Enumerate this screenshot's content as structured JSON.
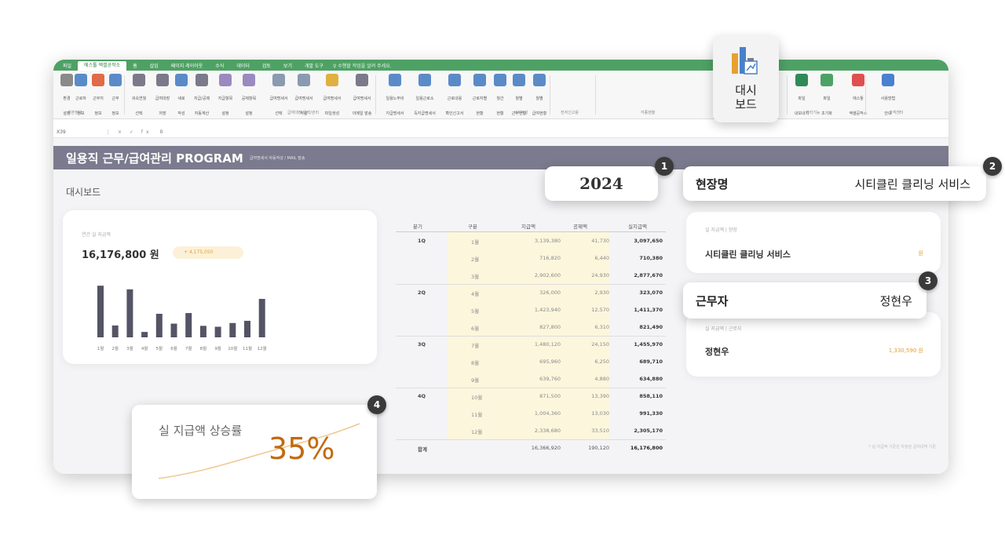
{
  "ribbon_tabs": [
    "파일",
    "에스툴 엑셀공작소",
    "홈",
    "삽입",
    "페이지 레이아웃",
    "수식",
    "데이터",
    "검토",
    "보기",
    "개발 도구"
  ],
  "tell_me": "♀ 수행할 작업을 알려 주세요.",
  "ribbon_buttons": [
    {
      "label": "환경\n설정",
      "icon": "gear-icon",
      "color": "#8a8a8a"
    },
    {
      "label": "근로자\n정보",
      "icon": "people-icon",
      "color": "#5a8bc8"
    },
    {
      "label": "근무지\n정보",
      "icon": "flag-icon",
      "color": "#e06a4a"
    },
    {
      "label": "근무\n정보",
      "icon": "clock-icon",
      "color": "#5a8bc8"
    },
    {
      "label": "귀속연월\n선택",
      "icon": "calendar-icon",
      "color": "#7a7a8a"
    },
    {
      "label": "급여대장\n저장",
      "icon": "save-icon",
      "color": "#7a7a8a"
    },
    {
      "label": "새로\n작성",
      "icon": "new-doc-icon",
      "color": "#5a8bc8"
    },
    {
      "label": "지급/공제\n자동계산",
      "icon": "calc-icon",
      "color": "#7a7a8a"
    },
    {
      "label": "지급항목\n설정",
      "icon": "edit-icon",
      "color": "#9a8ac0"
    },
    {
      "label": "공제항목\n설정",
      "icon": "edit-icon",
      "color": "#9a8ac0"
    },
    {
      "label": "급여명세서\n선택",
      "icon": "cursor-icon",
      "color": "#8a9ab0"
    },
    {
      "label": "급여명세서\n작성",
      "icon": "cursor-icon",
      "color": "#8a9ab0"
    },
    {
      "label": "급여명세서\n파일생성",
      "icon": "mail-icon",
      "color": "#e0b040"
    },
    {
      "label": "급여명세서\n이메일 발송",
      "icon": "send-icon",
      "color": "#7a7a8a"
    },
    {
      "label": "일용노무비\n지급명세서",
      "icon": "doc-icon",
      "color": "#5a8bc8"
    },
    {
      "label": "일용근로소\n득지급명세서",
      "icon": "doc-icon",
      "color": "#5a8bc8"
    },
    {
      "label": "근로내용\n확인신고서",
      "icon": "doc-icon",
      "color": "#5a8bc8"
    },
    {
      "label": "근로자별\n현황",
      "icon": "search-icon",
      "color": "#5a8bc8"
    },
    {
      "label": "월간\n현황",
      "icon": "calendar-icon",
      "color": "#5a8bc8"
    },
    {
      "label": "월별\n근무현황",
      "icon": "grid-icon",
      "color": "#5a8bc8"
    },
    {
      "label": "월별\n급여현황",
      "icon": "grid-icon",
      "color": "#5a8bc8"
    },
    {
      "label": "파일\n내보내기",
      "icon": "excel-icon",
      "color": "#2e8b57"
    },
    {
      "label": "파일\n초기화",
      "icon": "refresh-icon",
      "color": "#4ea164"
    },
    {
      "label": "에스툴\n엑셀공작소",
      "icon": "logo-icon",
      "color": "#e05050"
    },
    {
      "label": "사용방법\n안내",
      "icon": "info-icon",
      "color": "#4a80d0"
    }
  ],
  "ribbon_groups": [
    "기본정보",
    "급여대장 입력/관리",
    "서식작성",
    "전자신고용",
    "각종현황",
    "관리기능",
    "고객센터"
  ],
  "dashboard_button": {
    "line1": "대시",
    "line2": "보드"
  },
  "formula_bar": {
    "cell": "X39",
    "fx": "× ✓ fx",
    "formula": "0"
  },
  "title": "일용직 근무/급여관리 PROGRAM",
  "subtitle": "급여명세서 자동작성 / MAIL 발송",
  "dashboard_label": "대시보드",
  "annual_pay": {
    "label": "연간 실 지급액",
    "value": "16,176,800 원",
    "delta": "+ 4,175,050"
  },
  "chart_data": {
    "type": "bar",
    "categories": [
      "1월",
      "2월",
      "3월",
      "4월",
      "5월",
      "6월",
      "7월",
      "8월",
      "9월",
      "10월",
      "11월",
      "12월"
    ],
    "values": [
      3097650,
      710380,
      2877670,
      323070,
      1411370,
      821490,
      1455970,
      689710,
      634880,
      858110,
      991330,
      2305170
    ],
    "ylim": [
      0,
      3200000
    ],
    "color": "#545466"
  },
  "table": {
    "headers": [
      "분기",
      "구분",
      "지급액",
      "공제액",
      "실지급액"
    ],
    "rows": [
      {
        "q": "1Q",
        "m": "1월",
        "a": "3,139,380",
        "d": "41,730",
        "n": "3,097,650"
      },
      {
        "q": "",
        "m": "2월",
        "a": "716,820",
        "d": "6,440",
        "n": "710,380"
      },
      {
        "q": "",
        "m": "3월",
        "a": "2,902,600",
        "d": "24,930",
        "n": "2,877,670"
      },
      {
        "q": "2Q",
        "m": "4월",
        "a": "326,000",
        "d": "2,930",
        "n": "323,070"
      },
      {
        "q": "",
        "m": "5월",
        "a": "1,423,940",
        "d": "12,570",
        "n": "1,411,370"
      },
      {
        "q": "",
        "m": "6월",
        "a": "827,800",
        "d": "6,310",
        "n": "821,490"
      },
      {
        "q": "3Q",
        "m": "7월",
        "a": "1,480,120",
        "d": "24,150",
        "n": "1,455,970"
      },
      {
        "q": "",
        "m": "8월",
        "a": "695,960",
        "d": "6,250",
        "n": "689,710"
      },
      {
        "q": "",
        "m": "9월",
        "a": "639,760",
        "d": "4,880",
        "n": "634,880"
      },
      {
        "q": "4Q",
        "m": "10월",
        "a": "871,500",
        "d": "13,390",
        "n": "858,110"
      },
      {
        "q": "",
        "m": "11월",
        "a": "1,004,360",
        "d": "13,030",
        "n": "991,330"
      },
      {
        "q": "",
        "m": "12월",
        "a": "2,338,680",
        "d": "33,510",
        "n": "2,305,170"
      }
    ],
    "total": {
      "q": "합계",
      "m": "",
      "a": "16,366,920",
      "d": "190,120",
      "n": "16,176,800"
    }
  },
  "site_card": {
    "label": "실 지급액 | 현장",
    "name": "시티클린 클리닝 서비스",
    "suffix": "원"
  },
  "worker_card": {
    "label": "실 지급액 | 근로자",
    "name": "정현우",
    "value": "1,330,590 원"
  },
  "footnote": "* 실 지급액 기준은 차징된 급여내역 기준",
  "callouts": {
    "year": {
      "badge": "1",
      "value": "2024"
    },
    "site": {
      "badge": "2",
      "label": "현장명",
      "value": "시티클린 클리닝 서비스"
    },
    "worker": {
      "badge": "3",
      "label": "근무자",
      "value": "정현우"
    },
    "rate": {
      "badge": "4",
      "label": "실 지급액 상승률",
      "value": "35%"
    }
  }
}
